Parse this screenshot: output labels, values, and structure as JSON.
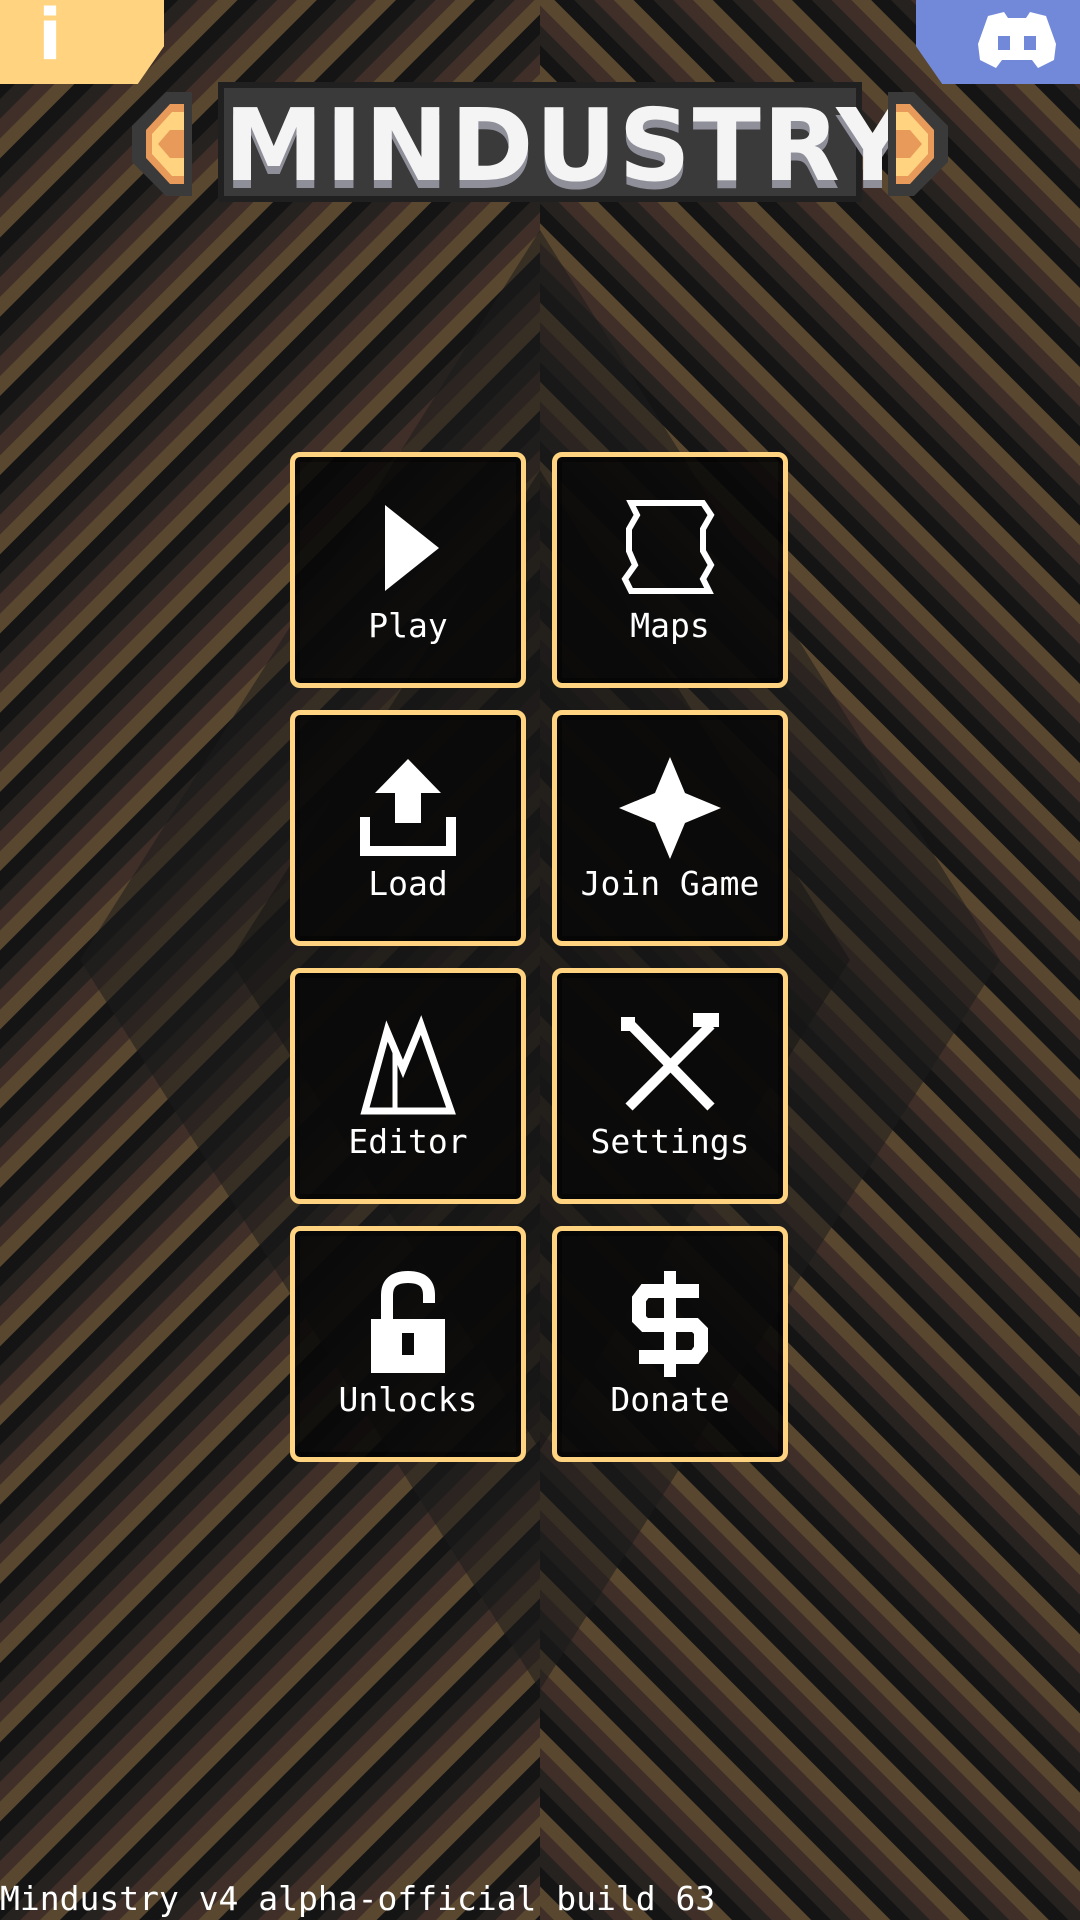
{
  "app": {
    "title": "MINDUSTRY"
  },
  "header": {
    "info_glyph": "i",
    "info_icon": "info-icon",
    "discord_icon": "discord-icon"
  },
  "menu": {
    "items": [
      {
        "label": "Play",
        "icon": "play-icon"
      },
      {
        "label": "Maps",
        "icon": "map-icon"
      },
      {
        "label": "Load",
        "icon": "upload-icon"
      },
      {
        "label": "Join Game",
        "icon": "join-icon"
      },
      {
        "label": "Editor",
        "icon": "editor-icon"
      },
      {
        "label": "Settings",
        "icon": "settings-icon"
      },
      {
        "label": "Unlocks",
        "icon": "lock-icon"
      },
      {
        "label": "Donate",
        "icon": "dollar-icon"
      }
    ]
  },
  "footer": {
    "version": "Mindustry v4 alpha-official build 63"
  },
  "colors": {
    "accent": "#ffd37f",
    "discord": "#7289da",
    "background": "#1c1c1c",
    "title_fill": "#f4f4f4",
    "title_shadow": "#8f8f9a",
    "wing_orange": "#e89a5a",
    "stripe_tan": "#8a6a3e",
    "stripe_brown": "#5e3e33",
    "stripe_dark": "#2e2623",
    "stripe_black": "#0e0e0e"
  }
}
